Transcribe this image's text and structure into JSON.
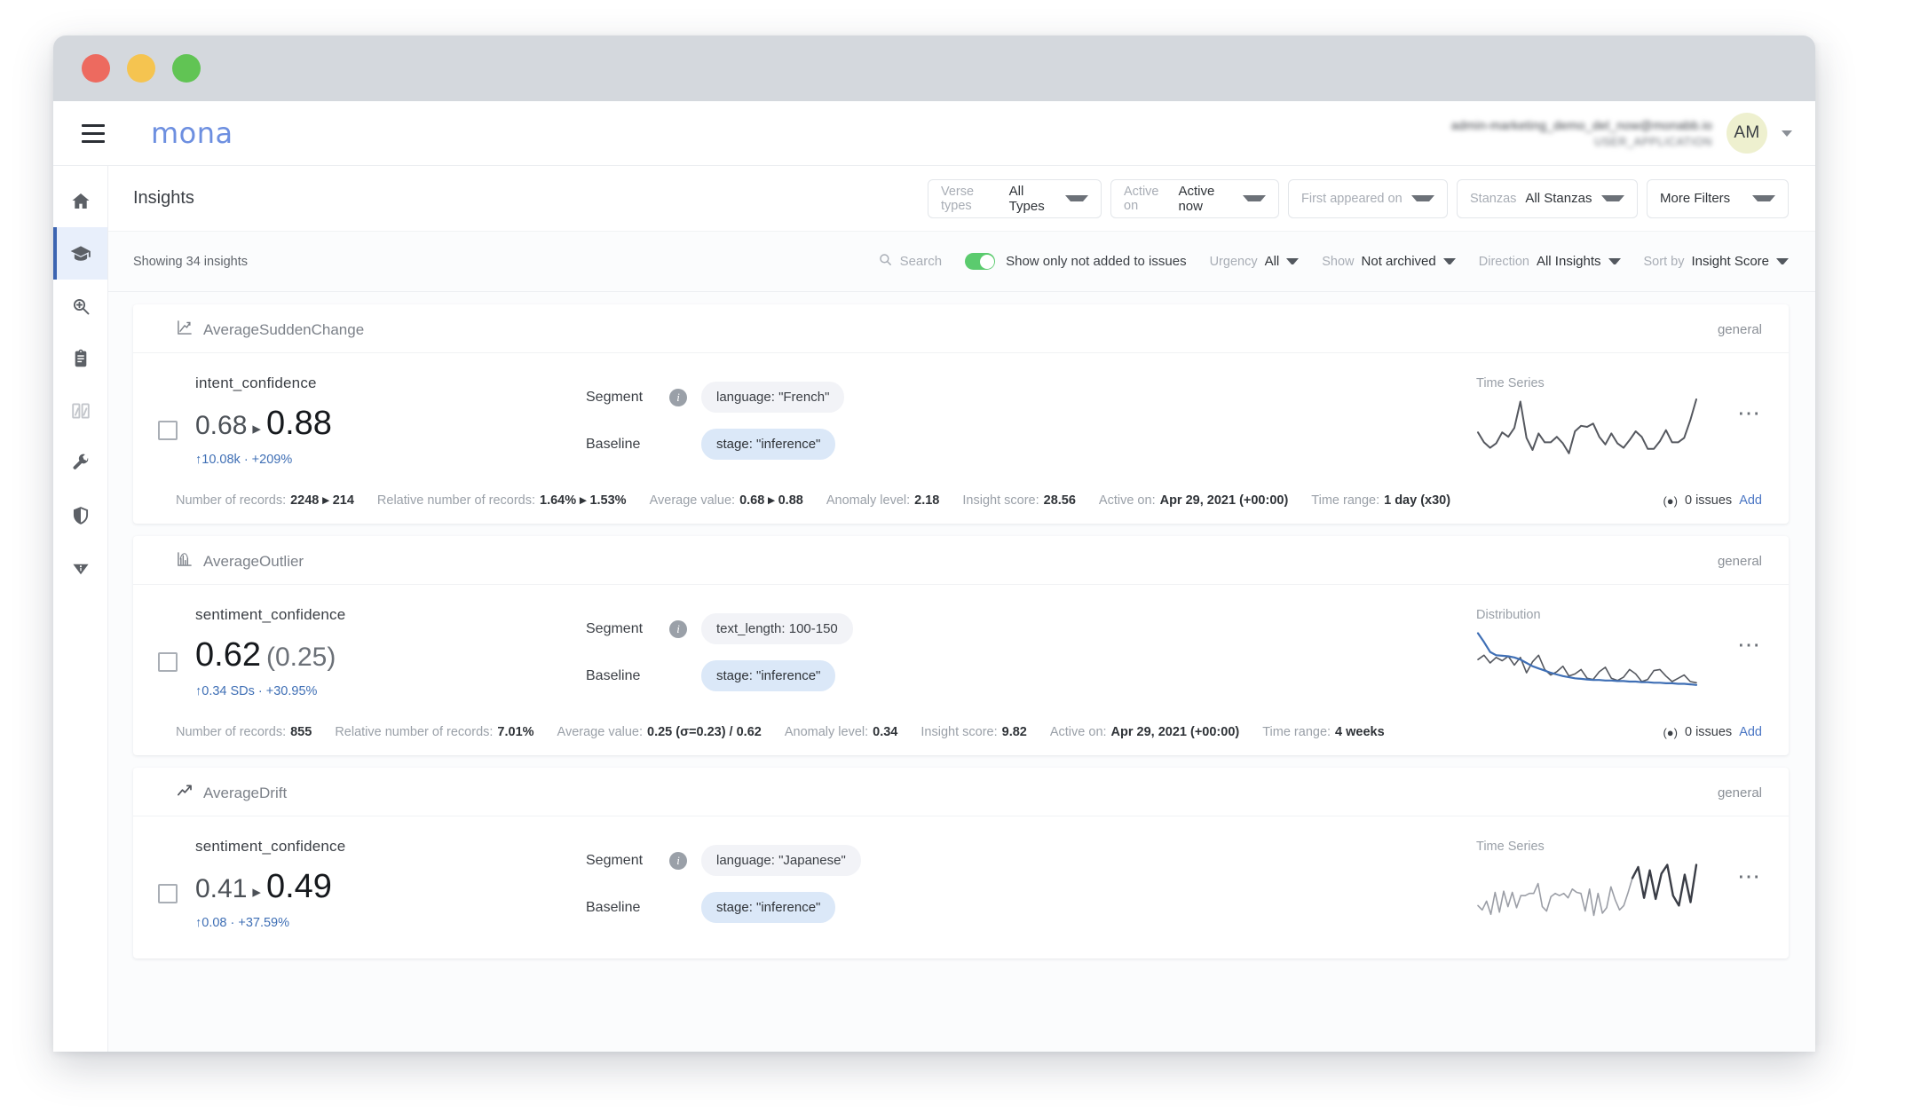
{
  "window": {
    "dots": [
      "close",
      "minimize",
      "maximize"
    ]
  },
  "appbar": {
    "menu_icon": "hamburger-icon",
    "brand": "mona",
    "user_email": "admin-marketing_demo_del_now@monabb.io",
    "user_role": "USER_APPLICATION",
    "avatar_initials": "AM"
  },
  "sidebar": {
    "items": [
      {
        "icon": "home-icon",
        "name": "home"
      },
      {
        "icon": "graduation-cap-icon",
        "name": "insights",
        "active": true
      },
      {
        "icon": "magnify-plus-icon",
        "name": "investigate"
      },
      {
        "icon": "clipboard-icon",
        "name": "reports"
      },
      {
        "icon": "compare-split-icon",
        "name": "compare"
      },
      {
        "icon": "wrench-icon",
        "name": "config"
      },
      {
        "icon": "shield-icon",
        "name": "security"
      },
      {
        "icon": "info-funnel-icon",
        "name": "about"
      }
    ]
  },
  "header": {
    "title": "Insights",
    "filters": [
      {
        "label": "Verse types",
        "value": "All Types",
        "name": "verse-types"
      },
      {
        "label": "Active on",
        "value": "Active now",
        "name": "active-on"
      },
      {
        "label": "First appeared on",
        "value": "",
        "name": "first-appeared-on"
      },
      {
        "label": "Stanzas",
        "value": "All Stanzas",
        "name": "stanzas"
      }
    ],
    "more_filters": "More Filters"
  },
  "toolbar": {
    "showing": "Showing 34 insights",
    "search_placeholder": "Search",
    "toggle_label": "Show only not added to issues",
    "toggle_on": true,
    "dropdowns": [
      {
        "label": "Urgency",
        "value": "All",
        "name": "urgency"
      },
      {
        "label": "Show",
        "value": "Not archived",
        "name": "show"
      },
      {
        "label": "Direction",
        "value": "All Insights",
        "name": "direction"
      },
      {
        "label": "Sort by",
        "value": "Insight Score",
        "name": "sort-by"
      }
    ]
  },
  "cards": [
    {
      "type": "AverageSuddenChange",
      "type_icon": "sudden-change-icon",
      "tag": "general",
      "metric_name": "intent_confidence",
      "value_from": "0.68",
      "value_arrow": "▸",
      "value_to": "0.88",
      "value_paren": "",
      "delta": "↑10.08k · +209%",
      "segment_label": "Segment",
      "segment_value": "language: \"French\"",
      "baseline_label": "Baseline",
      "baseline_value": "stage: \"inference\"",
      "chart_title": "Time Series",
      "meta": [
        {
          "k": "Number of records:",
          "v": "2248 ▸ 214"
        },
        {
          "k": "Relative number of records:",
          "v": "1.64% ▸ 1.53%"
        },
        {
          "k": "Average value:",
          "v": "0.68 ▸ 0.88"
        },
        {
          "k": "Anomaly level:",
          "v": "2.18"
        },
        {
          "k": "Insight score:",
          "v": "28.56"
        },
        {
          "k": "Active on:",
          "v": "Apr 29, 2021 (+00:00)"
        },
        {
          "k": "Time range:",
          "v": "1 day (x30)"
        }
      ],
      "issues_count": "0 issues",
      "issues_add": "Add"
    },
    {
      "type": "AverageOutlier",
      "type_icon": "outlier-histogram-icon",
      "tag": "general",
      "metric_name": "sentiment_confidence",
      "value_from": "",
      "value_arrow": "",
      "value_to": "0.62",
      "value_paren": "(0.25)",
      "delta": "↑0.34 SDs · +30.95%",
      "segment_label": "Segment",
      "segment_value": "text_length: 100-150",
      "baseline_label": "Baseline",
      "baseline_value": "stage: \"inference\"",
      "chart_title": "Distribution",
      "meta": [
        {
          "k": "Number of records:",
          "v": "855"
        },
        {
          "k": "Relative number of records:",
          "v": "7.01%"
        },
        {
          "k": "Average value:",
          "v": "0.25 (σ=0.23) / 0.62"
        },
        {
          "k": "Anomaly level:",
          "v": "0.34"
        },
        {
          "k": "Insight score:",
          "v": "9.82"
        },
        {
          "k": "Active on:",
          "v": "Apr 29, 2021 (+00:00)"
        },
        {
          "k": "Time range:",
          "v": "4 weeks"
        }
      ],
      "issues_count": "0 issues",
      "issues_add": "Add"
    },
    {
      "type": "AverageDrift",
      "type_icon": "trending-up-icon",
      "tag": "general",
      "metric_name": "sentiment_confidence",
      "value_from": "0.41",
      "value_arrow": "▸",
      "value_to": "0.49",
      "value_paren": "",
      "delta": "↑0.08 · +37.59%",
      "segment_label": "Segment",
      "segment_value": "language: \"Japanese\"",
      "baseline_label": "Baseline",
      "baseline_value": "stage: \"inference\"",
      "chart_title": "Time Series",
      "meta": [],
      "issues_count": "",
      "issues_add": ""
    }
  ],
  "chart_data": [
    {
      "type": "line",
      "title": "Time Series",
      "xlabel": "",
      "ylabel": "",
      "series": [
        {
          "name": "time series",
          "values": [
            40,
            22,
            12,
            20,
            40,
            32,
            48,
            96,
            30,
            8,
            38,
            22,
            22,
            32,
            20,
            2,
            42,
            52,
            50,
            56,
            32,
            18,
            38,
            20,
            12,
            26,
            42,
            32,
            10,
            10,
            24,
            44,
            22,
            22,
            30,
            62,
            100
          ]
        }
      ]
    },
    {
      "type": "line",
      "title": "Distribution",
      "xlabel": "",
      "ylabel": "",
      "series": [
        {
          "name": "baseline",
          "color": "#3f6fb5",
          "values": [
            96,
            80,
            62,
            56,
            55,
            54,
            52,
            48,
            42,
            36,
            32,
            28,
            24,
            21,
            18,
            16,
            14,
            13,
            12,
            11,
            11,
            10,
            10,
            9,
            9,
            8,
            8,
            7,
            7,
            6,
            6,
            5,
            5,
            4,
            4,
            3,
            2
          ]
        },
        {
          "name": "segment",
          "color": "#55585f",
          "values": [
            48,
            56,
            42,
            52,
            46,
            54,
            38,
            52,
            24,
            44,
            56,
            30,
            20,
            26,
            36,
            18,
            22,
            30,
            14,
            12,
            26,
            34,
            14,
            10,
            16,
            30,
            22,
            8,
            12,
            28,
            30,
            18,
            8,
            14,
            20,
            8,
            6
          ]
        }
      ]
    },
    {
      "type": "line",
      "title": "Time Series",
      "xlabel": "",
      "ylabel": "",
      "series": [
        {
          "name": "time series",
          "values": [
            22,
            14,
            30,
            6,
            46,
            10,
            48,
            20,
            46,
            18,
            40,
            40,
            44,
            44,
            62,
            20,
            12,
            38,
            44,
            40,
            44,
            36,
            52,
            46,
            44,
            12,
            52,
            4,
            44,
            8,
            18,
            56,
            32,
            14,
            22,
            46,
            72
          ]
        },
        {
          "name": "recent",
          "color": "#3a3d46",
          "values": [
            72,
            92,
            36,
            86,
            34,
            80,
            96,
            40,
            22,
            78,
            28,
            96
          ]
        }
      ]
    }
  ]
}
